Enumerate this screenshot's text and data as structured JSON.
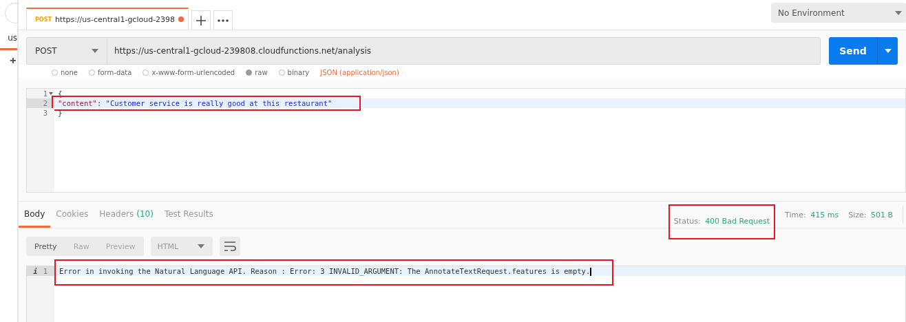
{
  "sidebar": {
    "tab": {
      "label": "us",
      "selected": true
    }
  },
  "tabs": [
    {
      "method": "POST",
      "title": "https://us-central1-gcloud-2398",
      "unsaved": true,
      "selected": true
    }
  ],
  "environment": {
    "value": "No Environment"
  },
  "request": {
    "method": "POST",
    "url": "https://us-central1-gcloud-239808.cloudfunctions.net/analysis",
    "send_label": "Send"
  },
  "body_types": [
    {
      "label": "none",
      "selected": false
    },
    {
      "label": "form-data",
      "selected": false
    },
    {
      "label": "x-www-form-urlencoded",
      "selected": false
    },
    {
      "label": "raw",
      "selected": true
    },
    {
      "label": "binary",
      "selected": false
    }
  ],
  "content_type": "JSON (application/json)",
  "request_body": [
    {
      "number": "1",
      "fold": true,
      "highlighted": false,
      "active": false,
      "tokens": [
        {
          "kind": "punct",
          "text": "{"
        }
      ]
    },
    {
      "number": "2",
      "fold": false,
      "highlighted": true,
      "active": true,
      "tokens": [
        {
          "kind": "key",
          "text": "\"content\""
        },
        {
          "kind": "punct",
          "text": ": "
        },
        {
          "kind": "string",
          "text": "\"Customer service is really good at this restaurant\""
        }
      ]
    },
    {
      "number": "3",
      "fold": false,
      "highlighted": false,
      "active": false,
      "tokens": [
        {
          "kind": "punct",
          "text": "}"
        }
      ]
    }
  ],
  "response_tabs": [
    {
      "label": "Body",
      "selected": true
    },
    {
      "label": "Cookies",
      "selected": false
    },
    {
      "label": "Headers",
      "count": "(10)",
      "selected": false
    },
    {
      "label": "Test Results",
      "selected": false
    }
  ],
  "status": {
    "label": "Status:",
    "value": "400 Bad Request",
    "highlighted": true
  },
  "time": {
    "label": "Time:",
    "value": "415 ms"
  },
  "size": {
    "label": "Size:",
    "value": "501 B"
  },
  "view_modes": [
    {
      "label": "Pretty",
      "selected": true
    },
    {
      "label": "Raw",
      "selected": false
    },
    {
      "label": "Preview",
      "selected": false
    }
  ],
  "format": {
    "value": "HTML"
  },
  "response_body": {
    "highlighted": true,
    "lines": [
      {
        "number": "1",
        "marker": "i",
        "text": "Error in invoking the Natural Language API. Reason : Error: 3 INVALID_ARGUMENT: The AnnotateTextRequest.features is empty."
      }
    ]
  }
}
